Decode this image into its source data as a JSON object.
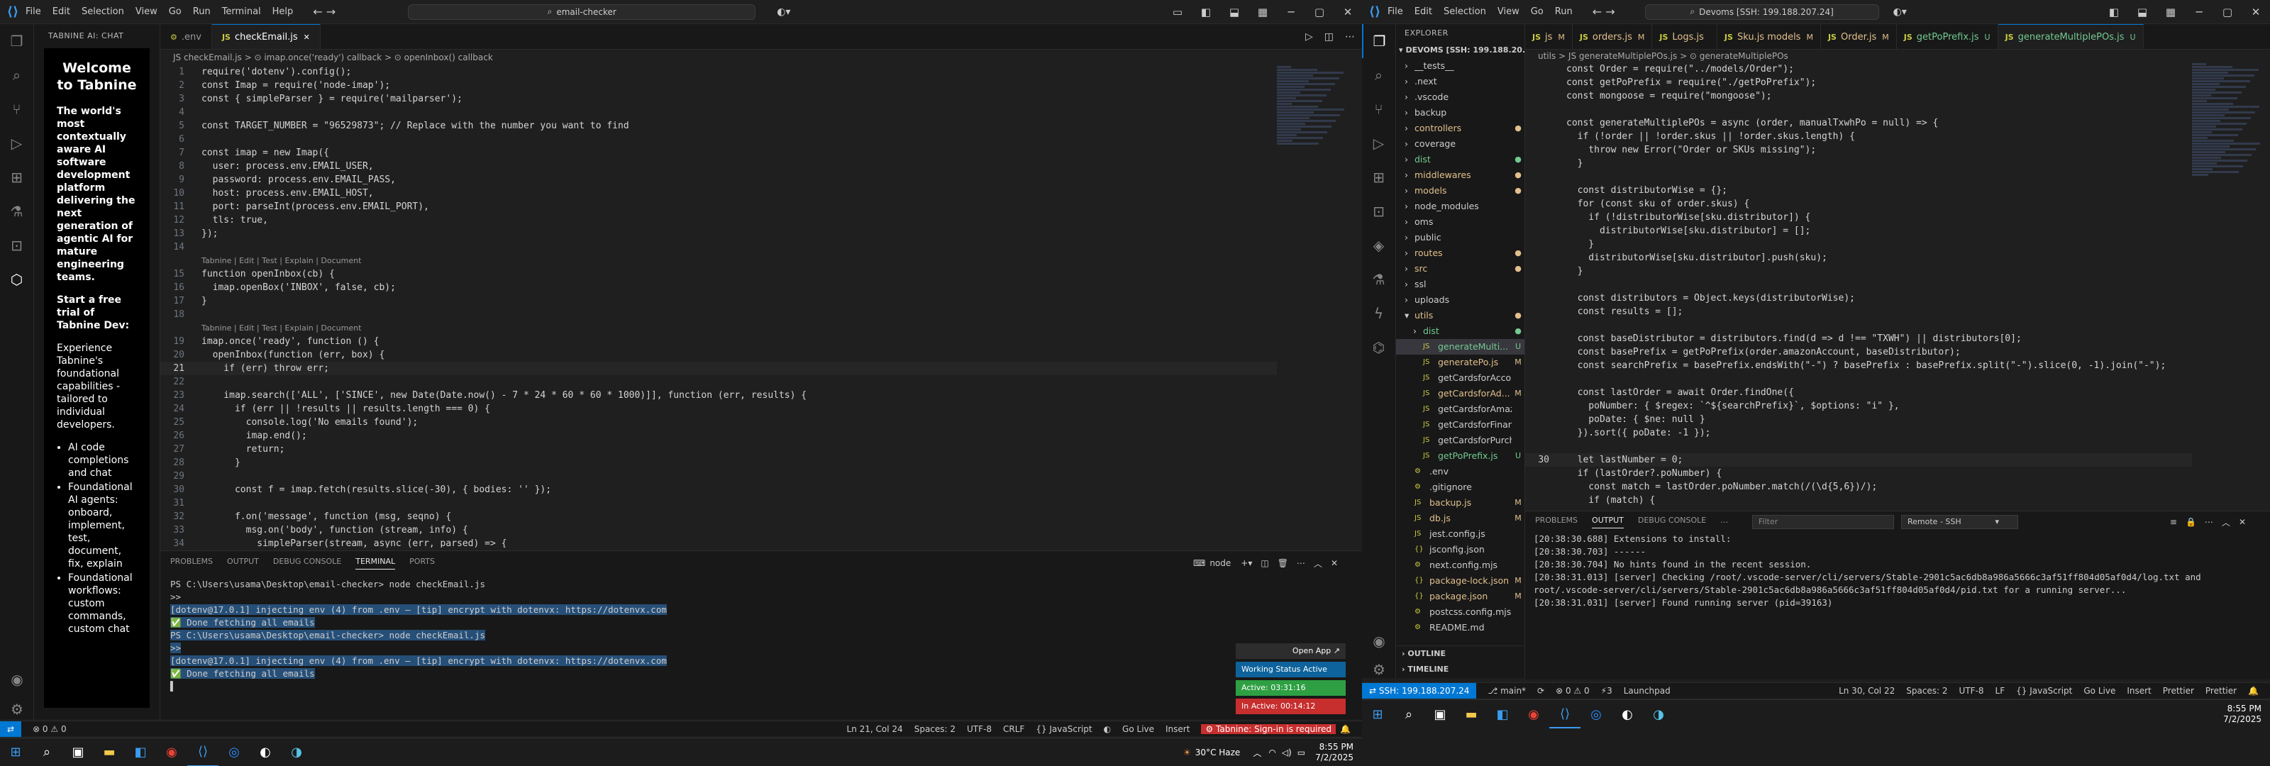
{
  "left": {
    "title": {
      "menu": [
        "File",
        "Edit",
        "Selection",
        "View",
        "Go",
        "Run",
        "Terminal",
        "Help"
      ],
      "search": "email-checker"
    },
    "sidebar": {
      "header": "TABNINE AI: CHAT",
      "welcome": "Welcome to Tabnine",
      "tagline": "The world's most contextually aware AI software development platform delivering the next generation of agentic AI for mature engineering teams.",
      "trial": "Start a free trial of Tabnine Dev:",
      "experience": "Experience Tabnine's foundational capabilities - tailored to individual developers.",
      "features": [
        "AI code completions and chat",
        "Foundational AI agents: onboard, implement, test, document, fix, explain",
        "Foundational workflows: custom commands, custom chat"
      ]
    },
    "tabs": [
      {
        "name": ".env",
        "icon": "⚙",
        "active": false
      },
      {
        "name": "checkEmail.js",
        "icon": "JS",
        "active": true
      }
    ],
    "breadcrumb": "JS checkEmail.js > ⊙ imap.once('ready') callback > ⊙ openInbox() callback",
    "lines": [
      {
        "t": "line",
        "n": "1",
        "c": "require('dotenv').config();"
      },
      {
        "t": "line",
        "n": "2",
        "c": "const Imap = require('node-imap');"
      },
      {
        "t": "line",
        "n": "3",
        "c": "const { simpleParser } = require('mailparser');"
      },
      {
        "t": "line",
        "n": "4",
        "c": ""
      },
      {
        "t": "line",
        "n": "5",
        "c": "const TARGET_NUMBER = \"96529873\"; // Replace with the number you want to find"
      },
      {
        "t": "line",
        "n": "6",
        "c": ""
      },
      {
        "t": "line",
        "n": "7",
        "c": "const imap = new Imap({"
      },
      {
        "t": "line",
        "n": "8",
        "c": "  user: process.env.EMAIL_USER,"
      },
      {
        "t": "line",
        "n": "9",
        "c": "  password: process.env.EMAIL_PASS,"
      },
      {
        "t": "line",
        "n": "10",
        "c": "  host: process.env.EMAIL_HOST,"
      },
      {
        "t": "line",
        "n": "11",
        "c": "  port: parseInt(process.env.EMAIL_PORT),"
      },
      {
        "t": "line",
        "n": "12",
        "c": "  tls: true,"
      },
      {
        "t": "line",
        "n": "13",
        "c": "});"
      },
      {
        "t": "line",
        "n": "14",
        "c": ""
      },
      {
        "t": "lens",
        "c": "Tabnine | Edit | Test | Explain | Document"
      },
      {
        "t": "line",
        "n": "15",
        "c": "function openInbox(cb) {"
      },
      {
        "t": "line",
        "n": "16",
        "c": "  imap.openBox('INBOX', false, cb);"
      },
      {
        "t": "line",
        "n": "17",
        "c": "}"
      },
      {
        "t": "line",
        "n": "18",
        "c": ""
      },
      {
        "t": "lens",
        "c": "Tabnine | Edit | Test | Explain | Document"
      },
      {
        "t": "line",
        "n": "19",
        "c": "imap.once('ready', function () {"
      },
      {
        "t": "line",
        "n": "20",
        "c": "  openInbox(function (err, box) {"
      },
      {
        "t": "line",
        "n": "21",
        "c": "    if (err) throw err;"
      },
      {
        "t": "line",
        "n": "22",
        "c": ""
      },
      {
        "t": "line",
        "n": "23",
        "c": "    imap.search(['ALL', ['SINCE', new Date(Date.now() - 7 * 24 * 60 * 60 * 1000)]], function (err, results) {"
      },
      {
        "t": "line",
        "n": "24",
        "c": "      if (err || !results || results.length === 0) {"
      },
      {
        "t": "line",
        "n": "25",
        "c": "        console.log('No emails found');"
      },
      {
        "t": "line",
        "n": "26",
        "c": "        imap.end();"
      },
      {
        "t": "line",
        "n": "27",
        "c": "        return;"
      },
      {
        "t": "line",
        "n": "28",
        "c": "      }"
      },
      {
        "t": "line",
        "n": "29",
        "c": ""
      },
      {
        "t": "line",
        "n": "30",
        "c": "      const f = imap.fetch(results.slice(-30), { bodies: '' });"
      },
      {
        "t": "line",
        "n": "31",
        "c": ""
      },
      {
        "t": "line",
        "n": "32",
        "c": "      f.on('message', function (msg, seqno) {"
      },
      {
        "t": "line",
        "n": "33",
        "c": "        msg.on('body', function (stream, info) {"
      },
      {
        "t": "line",
        "n": "34",
        "c": "          simpleParser(stream, async (err, parsed) => {"
      }
    ],
    "panel": {
      "tabs": [
        "PROBLEMS",
        "OUTPUT",
        "DEBUG CONSOLE",
        "TERMINAL",
        "PORTS"
      ],
      "shell": "node",
      "terminal": [
        {
          "c": "PS C:\\Users\\usama\\Desktop\\email-checker> node checkEmail.js",
          "sel": false
        },
        {
          "c": ">>",
          "sel": false
        },
        {
          "c": "[dotenv@17.0.1] injecting env (4) from .env – [tip] encrypt with dotenvx: https://dotenvx.com",
          "sel": true
        },
        {
          "c": "✅ Done fetching all emails",
          "sel": true
        },
        {
          "c": "PS C:\\Users\\usama\\Desktop\\email-checker> node checkEmail.js",
          "sel": true
        },
        {
          "c": ">>",
          "sel": true
        },
        {
          "c": "[dotenv@17.0.1] injecting env (4) from .env – [tip] encrypt with dotenvx: https://dotenvx.com",
          "sel": true
        },
        {
          "c": "✅ Done fetching all emails",
          "sel": true
        },
        {
          "c": "▌",
          "sel": false
        }
      ]
    },
    "popup": {
      "open_app": "Open App ↗",
      "working": "Working Status Active",
      "active": "Active: 03:31:16",
      "inactive": "In Active: 00:14:12"
    },
    "status": {
      "errors": "⊗ 0 ⚠ 0",
      "pos": "Ln 21, Col 24",
      "spaces": "Spaces: 2",
      "enc": "UTF-8",
      "eol": "CRLF",
      "lang": "{} JavaScript",
      "golive": "Go Live",
      "insert": "Insert",
      "tabnine": "⚙ Tabnine: Sign-in is required"
    },
    "taskbar": {
      "weather": "30°C Haze",
      "time": "8:55 PM",
      "date": "7/2/2025"
    }
  },
  "right": {
    "title": {
      "menu": [
        "File",
        "Edit",
        "Selection",
        "View",
        "Go",
        "Run"
      ],
      "search": "Devoms [SSH: 199.188.207.24]"
    },
    "explorer": {
      "header": "EXPLORER",
      "root": "DEVOMS [SSH: 199.188.20...",
      "items": [
        {
          "n": "__tests__",
          "d": 1,
          "f": true,
          "s": ""
        },
        {
          "n": ".next",
          "d": 1,
          "f": true,
          "s": ""
        },
        {
          "n": ".vscode",
          "d": 1,
          "f": true,
          "s": ""
        },
        {
          "n": "backup",
          "d": 1,
          "f": true,
          "s": ""
        },
        {
          "n": "controllers",
          "d": 1,
          "f": true,
          "s": "●",
          "c": "#e2c08d"
        },
        {
          "n": "coverage",
          "d": 1,
          "f": true,
          "s": ""
        },
        {
          "n": "dist",
          "d": 1,
          "f": true,
          "s": "●",
          "c": "#73c991"
        },
        {
          "n": "middlewares",
          "d": 1,
          "f": true,
          "s": "●",
          "c": "#e2c08d"
        },
        {
          "n": "models",
          "d": 1,
          "f": true,
          "s": "●",
          "c": "#e2c08d"
        },
        {
          "n": "node_modules",
          "d": 1,
          "f": true,
          "s": ""
        },
        {
          "n": "oms",
          "d": 1,
          "f": true,
          "s": ""
        },
        {
          "n": "public",
          "d": 1,
          "f": true,
          "s": ""
        },
        {
          "n": "routes",
          "d": 1,
          "f": true,
          "s": "●",
          "c": "#e2c08d"
        },
        {
          "n": "src",
          "d": 1,
          "f": true,
          "s": "●",
          "c": "#e2c08d"
        },
        {
          "n": "ssl",
          "d": 1,
          "f": true,
          "s": ""
        },
        {
          "n": "uploads",
          "d": 1,
          "f": true,
          "s": ""
        },
        {
          "n": "utils",
          "d": 1,
          "f": true,
          "s": "●",
          "c": "#e2c08d",
          "open": true
        },
        {
          "n": "dist",
          "d": 2,
          "f": true,
          "s": "●",
          "c": "#73c991"
        },
        {
          "n": "generateMulti...",
          "d": 2,
          "f": false,
          "s": "U",
          "c": "#73c991",
          "sel": true
        },
        {
          "n": "generatePo.js",
          "d": 2,
          "f": false,
          "s": "M",
          "c": "#e2c08d"
        },
        {
          "n": "getCardsforAccount.js",
          "d": 2,
          "f": false,
          "s": ""
        },
        {
          "n": "getCardsforAd...",
          "d": 2,
          "f": false,
          "s": "M",
          "c": "#e2c08d"
        },
        {
          "n": "getCardsforAmazon.js",
          "d": 2,
          "f": false,
          "s": ""
        },
        {
          "n": "getCardsforFinance.js",
          "d": 2,
          "f": false,
          "s": ""
        },
        {
          "n": "getCardsforPurchasi...",
          "d": 2,
          "f": false,
          "s": ""
        },
        {
          "n": "getPoPrefix.js",
          "d": 2,
          "f": false,
          "s": "U",
          "c": "#73c991"
        },
        {
          "n": ".env",
          "d": 1,
          "f": false,
          "s": ""
        },
        {
          "n": ".gitignore",
          "d": 1,
          "f": false,
          "s": ""
        },
        {
          "n": "backup.js",
          "d": 1,
          "f": false,
          "s": "M",
          "c": "#e2c08d"
        },
        {
          "n": "db.js",
          "d": 1,
          "f": false,
          "s": "M",
          "c": "#e2c08d"
        },
        {
          "n": "jest.config.js",
          "d": 1,
          "f": false,
          "s": ""
        },
        {
          "n": "jsconfig.json",
          "d": 1,
          "f": false,
          "s": ""
        },
        {
          "n": "next.config.mjs",
          "d": 1,
          "f": false,
          "s": ""
        },
        {
          "n": "package-lock.json",
          "d": 1,
          "f": false,
          "s": "M",
          "c": "#e2c08d"
        },
        {
          "n": "package.json",
          "d": 1,
          "f": false,
          "s": "M",
          "c": "#e2c08d"
        },
        {
          "n": "postcss.config.mjs",
          "d": 1,
          "f": false,
          "s": ""
        },
        {
          "n": "README.md",
          "d": 1,
          "f": false,
          "s": ""
        }
      ],
      "outline": "OUTLINE",
      "timeline": "TIMELINE"
    },
    "tabs": [
      {
        "name": "js",
        "mk": "M"
      },
      {
        "name": "orders.js",
        "mk": "M"
      },
      {
        "name": "Logs.js",
        "mk": ""
      },
      {
        "name": "Sku.js models",
        "mk": "M"
      },
      {
        "name": "Order.js",
        "mk": "M"
      },
      {
        "name": "getPoPrefix.js",
        "mk": "U"
      },
      {
        "name": "generateMultiplePOs.js",
        "mk": "U",
        "active": true
      }
    ],
    "breadcrumb": "utils > JS generateMultiplePOs.js > ⊙ generateMultiplePOs",
    "lines": [
      {
        "n": "",
        "c": "const Order = require(\"../models/Order\");"
      },
      {
        "n": "",
        "c": "const getPoPrefix = require(\"./getPoPrefix\");"
      },
      {
        "n": "",
        "c": "const mongoose = require(\"mongoose\");"
      },
      {
        "n": "",
        "c": ""
      },
      {
        "n": "",
        "c": "const generateMultiplePOs = async (order, manualTxwhPo = null) => {"
      },
      {
        "n": "",
        "c": "  if (!order || !order.skus || !order.skus.length) {"
      },
      {
        "n": "",
        "c": "    throw new Error(\"Order or SKUs missing\");"
      },
      {
        "n": "",
        "c": "  }"
      },
      {
        "n": "",
        "c": ""
      },
      {
        "n": "",
        "c": "  const distributorWise = {};"
      },
      {
        "n": "",
        "c": "  for (const sku of order.skus) {"
      },
      {
        "n": "",
        "c": "    if (!distributorWise[sku.distributor]) {"
      },
      {
        "n": "",
        "c": "      distributorWise[sku.distributor] = [];"
      },
      {
        "n": "",
        "c": "    }"
      },
      {
        "n": "",
        "c": "    distributorWise[sku.distributor].push(sku);"
      },
      {
        "n": "",
        "c": "  }"
      },
      {
        "n": "",
        "c": ""
      },
      {
        "n": "",
        "c": "  const distributors = Object.keys(distributorWise);"
      },
      {
        "n": "",
        "c": "  const results = [];"
      },
      {
        "n": "",
        "c": ""
      },
      {
        "n": "",
        "c": "  const baseDistributor = distributors.find(d => d !== \"TXWH\") || distributors[0];"
      },
      {
        "n": "",
        "c": "  const basePrefix = getPoPrefix(order.amazonAccount, baseDistributor);"
      },
      {
        "n": "",
        "c": "  const searchPrefix = basePrefix.endsWith(\"-\") ? basePrefix : basePrefix.split(\"-\").slice(0, -1).join(\"-\");"
      },
      {
        "n": "",
        "c": ""
      },
      {
        "n": "",
        "c": "  const lastOrder = await Order.findOne({"
      },
      {
        "n": "",
        "c": "    poNumber: { $regex: `^${searchPrefix}`, $options: \"i\" },"
      },
      {
        "n": "",
        "c": "    poDate: { $ne: null }"
      },
      {
        "n": "",
        "c": "  }).sort({ poDate: -1 });"
      },
      {
        "n": "",
        "c": ""
      },
      {
        "n": "30",
        "c": "  let lastNumber = 0;",
        "cur": true
      },
      {
        "n": "",
        "c": "  if (lastOrder?.poNumber) {"
      },
      {
        "n": "",
        "c": "    const match = lastOrder.poNumber.match(/(\\d{5,6})/);"
      },
      {
        "n": "",
        "c": "    if (match) {"
      }
    ],
    "panel": {
      "tabs": [
        "PROBLEMS",
        "OUTPUT",
        "DEBUG CONSOLE",
        "…"
      ],
      "filter": "Filter",
      "channel": "Remote - SSH",
      "log": [
        "[20:38:30.688] Extensions to install:",
        "[20:38:30.703] ------",
        "",
        "",
        "",
        "[20:38:30.704] No hints found in the recent session.",
        "[20:38:31.013] [server] Checking /root/.vscode-server/cli/servers/Stable-2901c5ac6db8a986a5666c3af51ff804d05af0d4/log.txt and",
        "root/.vscode-server/cli/servers/Stable-2901c5ac6db8a986a5666c3af51ff804d05af0d4/pid.txt for a running server...",
        "[20:38:31.031] [server] Found running server (pid=39163)"
      ]
    },
    "status": {
      "remote": "⇄ SSH: 199.188.207.24",
      "branch": "⎇ main*",
      "sync": "⟳",
      "errors": "⊗ 0 ⚠ 0",
      "ports": "⚡3",
      "launchpad": "Launchpad",
      "pos": "Ln 30, Col 22",
      "spaces": "Spaces: 2",
      "enc": "UTF-8",
      "eol": "LF",
      "lang": "{} JavaScript",
      "golive": "Go Live",
      "insert": "Insert",
      "prettier1": "Prettier",
      "prettier2": "Prettier"
    },
    "taskbar": {
      "time": "8:55 PM",
      "date": "7/2/2025"
    }
  }
}
